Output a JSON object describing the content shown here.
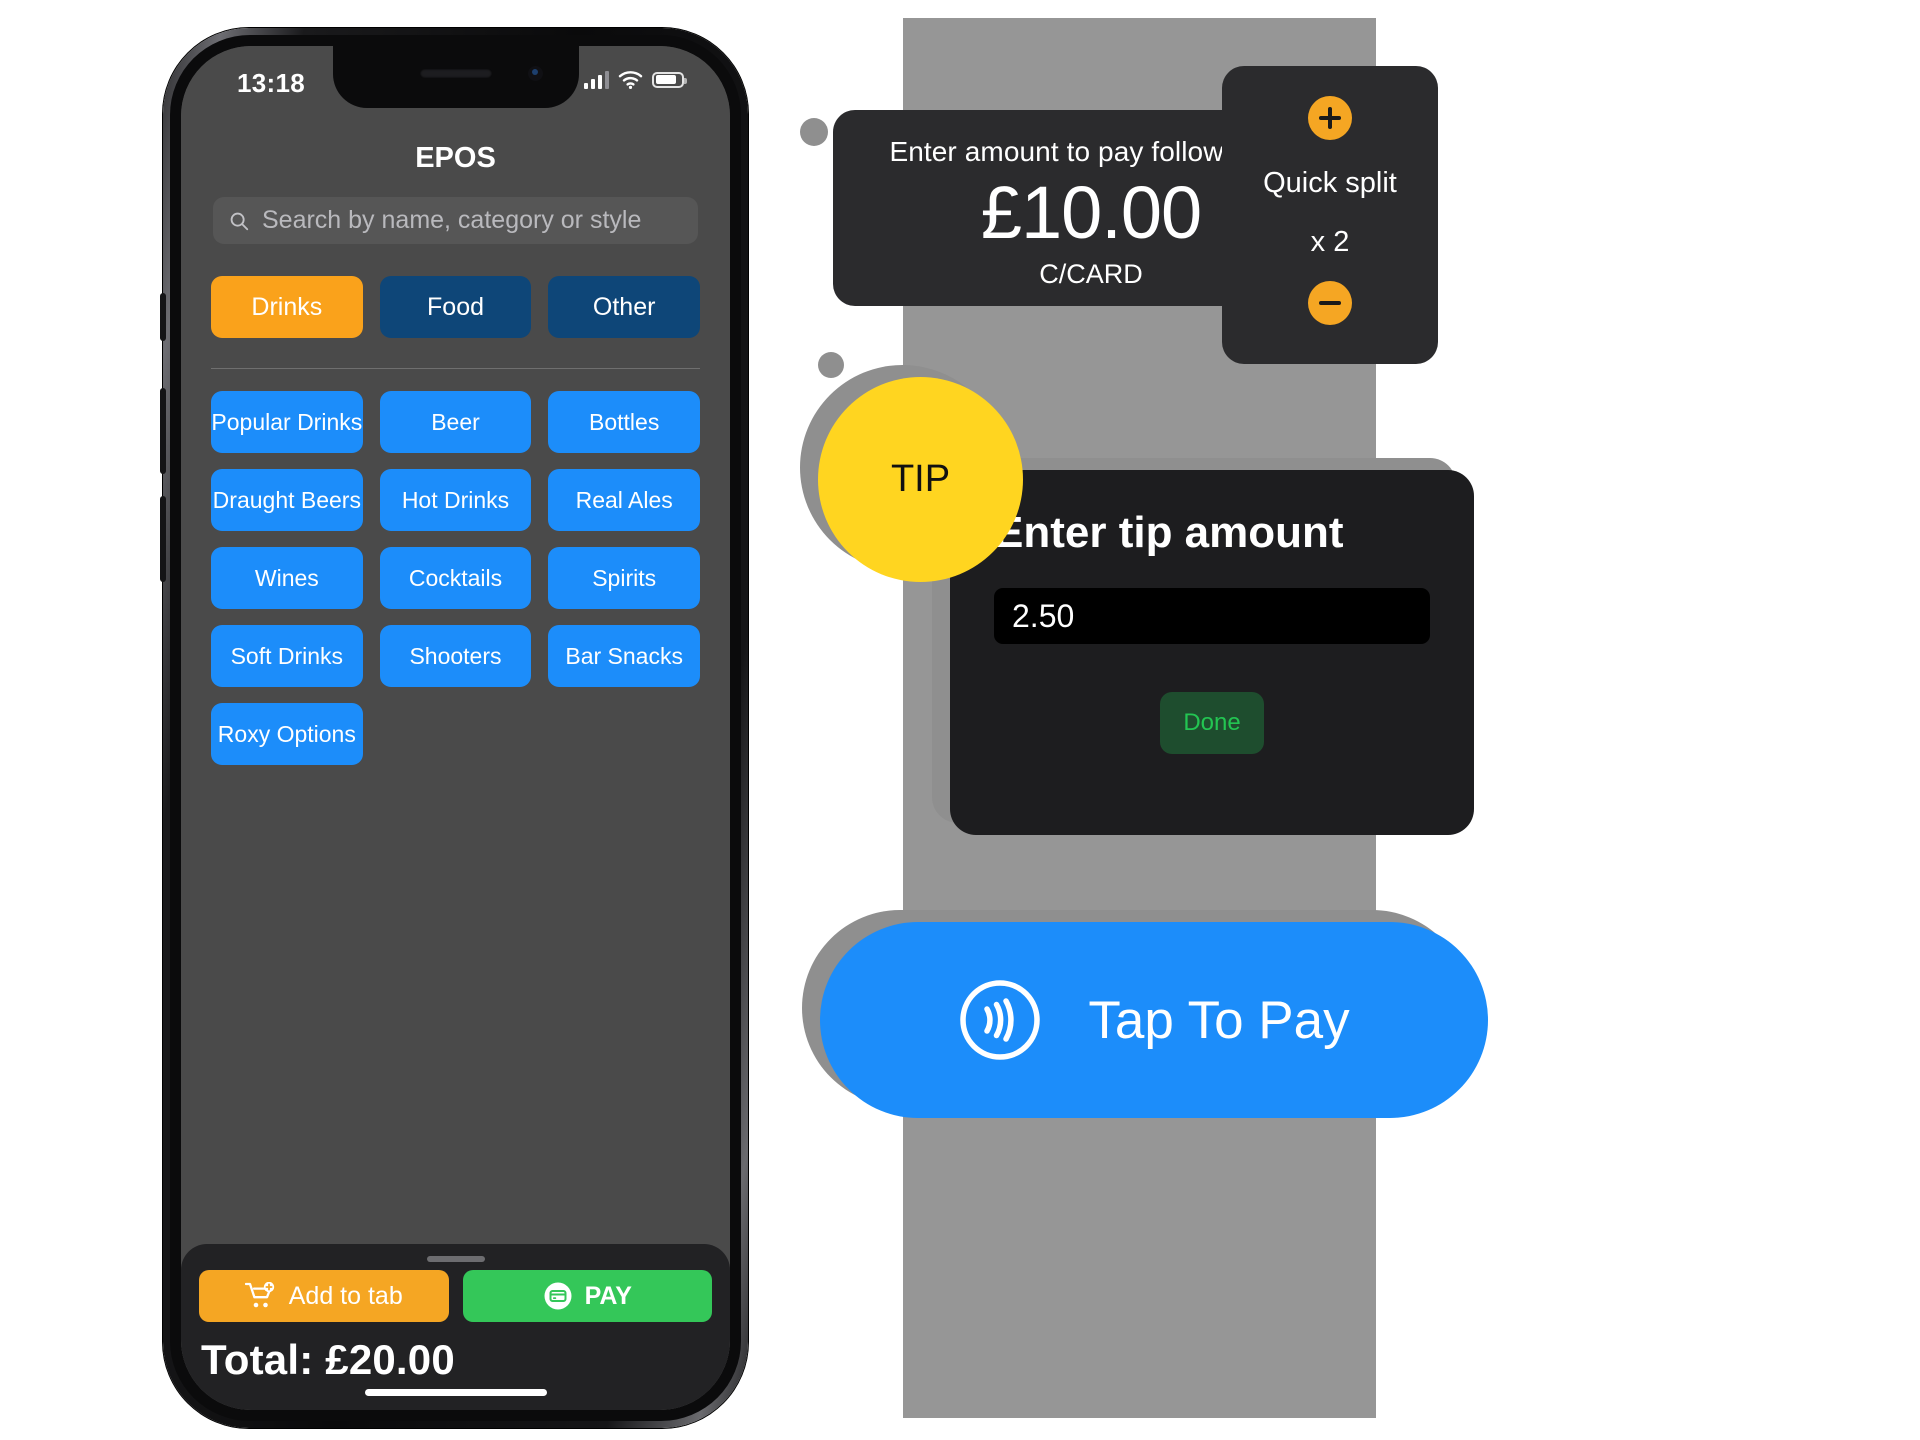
{
  "phone": {
    "status_bar": {
      "time": "13:18",
      "mute_icon": "bell-slash-icon",
      "signal_icon": "cellular-bars-icon",
      "wifi_icon": "wifi-icon",
      "battery_icon": "battery-icon"
    },
    "app_title": "EPOS",
    "search": {
      "icon": "search-icon",
      "placeholder": "Search by name, category or style",
      "value": ""
    },
    "categories": [
      {
        "label": "Drinks",
        "active": true
      },
      {
        "label": "Food",
        "active": false
      },
      {
        "label": "Other",
        "active": false
      }
    ],
    "subcategories": [
      "Popular Drinks",
      "Beer",
      "Bottles",
      "Draught Beers",
      "Hot Drinks",
      "Real Ales",
      "Wines",
      "Cocktails",
      "Spirits",
      "Soft Drinks",
      "Shooters",
      "Bar Snacks",
      "Roxy Options"
    ],
    "bottom_bar": {
      "add_to_tab_label": "Add to tab",
      "add_to_tab_icon": "cart-plus-icon",
      "pay_label": "PAY",
      "pay_icon": "credit-card-icon",
      "total_label": "Total: £20.00"
    }
  },
  "terminal": {
    "amount_card": {
      "prompt": "Enter amount to pay followed by",
      "amount": "£10.00",
      "method": "C/CARD"
    },
    "quick_split": {
      "increase_icon": "plus-circle-icon",
      "label": "Quick split",
      "count": "x 2",
      "decrease_icon": "minus-circle-icon"
    },
    "tip_badge": {
      "label": "TIP"
    },
    "tip_dialog": {
      "title": "Enter tip amount",
      "input_value": "2.50",
      "done_label": "Done"
    },
    "tap_to_pay": {
      "label": "Tap To Pay",
      "icon": "contactless-icon"
    }
  },
  "colors": {
    "accent_orange": "#F5A623",
    "category_active": "#FAA21B",
    "category_idle": "#0E4678",
    "grid_blue": "#1C8DFA",
    "pay_green": "#34C759",
    "done_green": "#23C552",
    "done_bg": "#1E4D2E",
    "tip_yellow": "#FFD520",
    "panel_gray": "#969696",
    "screen_gray": "#4A4A4A",
    "card_dark": "#2B2B2D"
  }
}
